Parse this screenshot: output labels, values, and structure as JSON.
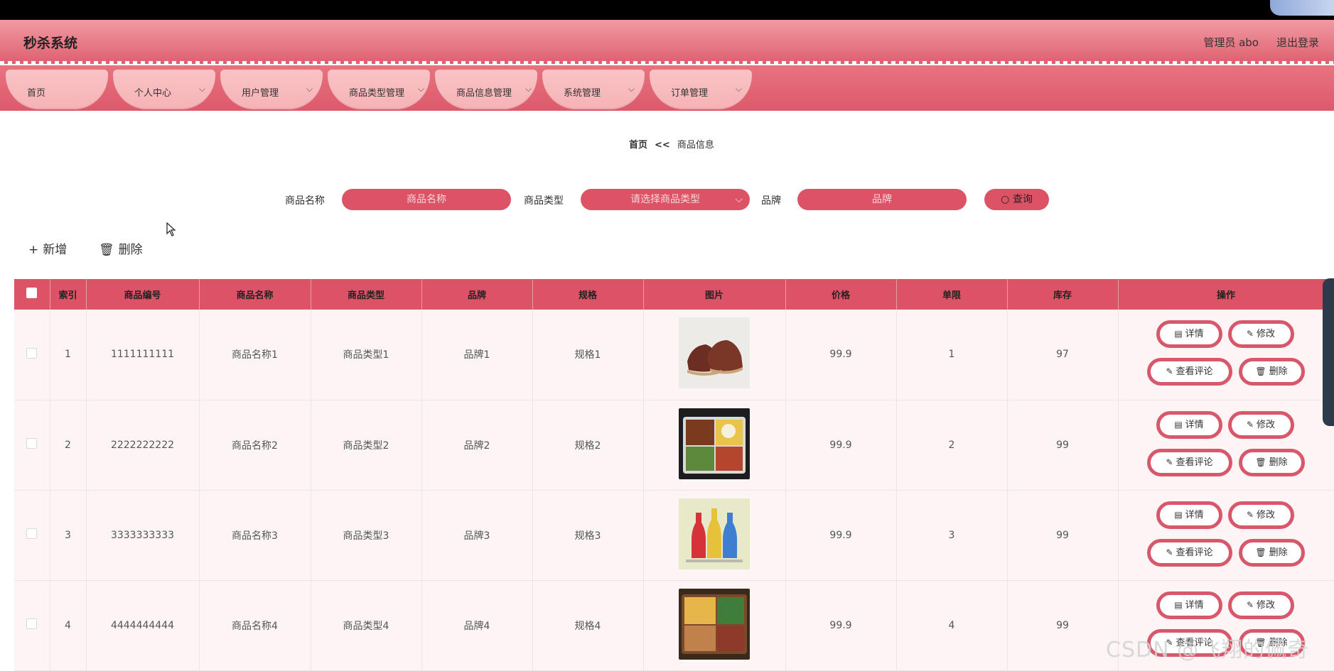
{
  "header": {
    "brand": "秒杀系统",
    "user": "管理员 abo",
    "logout": "退出登录"
  },
  "nav": [
    {
      "label": "首页",
      "chevron": false
    },
    {
      "label": "个人中心",
      "chevron": true
    },
    {
      "label": "用户管理",
      "chevron": true
    },
    {
      "label": "商品类型管理",
      "chevron": true
    },
    {
      "label": "商品信息管理",
      "chevron": true
    },
    {
      "label": "系统管理",
      "chevron": true
    },
    {
      "label": "订单管理",
      "chevron": true
    }
  ],
  "breadcrumb": {
    "home": "首页",
    "sep": "<<",
    "current": "商品信息"
  },
  "search": {
    "name_label": "商品名称",
    "name_placeholder": "商品名称",
    "type_label": "商品类型",
    "type_placeholder": "请选择商品类型",
    "brand_label": "品牌",
    "brand_placeholder": "品牌",
    "query_label": "查询"
  },
  "actions": {
    "add": "新增",
    "delete": "删除"
  },
  "table": {
    "headers": [
      "索引",
      "商品编号",
      "商品名称",
      "商品类型",
      "品牌",
      "规格",
      "图片",
      "价格",
      "单限",
      "库存",
      "操作"
    ],
    "rows": [
      {
        "index": "1",
        "code": "1111111111",
        "name": "商品名称1",
        "type": "商品类型1",
        "brand": "品牌1",
        "spec": "规格1",
        "image": "brown-leather-shoes",
        "price": "99.9",
        "limit": "1",
        "stock": "97"
      },
      {
        "index": "2",
        "code": "2222222222",
        "name": "商品名称2",
        "type": "商品类型2",
        "brand": "品牌2",
        "spec": "规格2",
        "image": "bento-meal-box",
        "price": "99.9",
        "limit": "2",
        "stock": "99"
      },
      {
        "index": "3",
        "code": "3333333333",
        "name": "商品名称3",
        "type": "商品类型3",
        "brand": "品牌3",
        "spec": "规格3",
        "image": "three-colored-bottles",
        "price": "99.9",
        "limit": "3",
        "stock": "99"
      },
      {
        "index": "4",
        "code": "4444444444",
        "name": "商品名称4",
        "type": "商品类型4",
        "brand": "品牌4",
        "spec": "规格4",
        "image": "divided-food-tray",
        "price": "99.9",
        "limit": "4",
        "stock": "99"
      }
    ],
    "row_actions": {
      "detail": "详情",
      "edit": "修改",
      "comments": "查看评论",
      "delete": "删除"
    }
  },
  "watermark": "CSDN @飞翔的佩奇",
  "colors": {
    "primary": "#dc5366",
    "nav_tab": "#f9c3c5",
    "row_bg": "#fdf5f5"
  }
}
